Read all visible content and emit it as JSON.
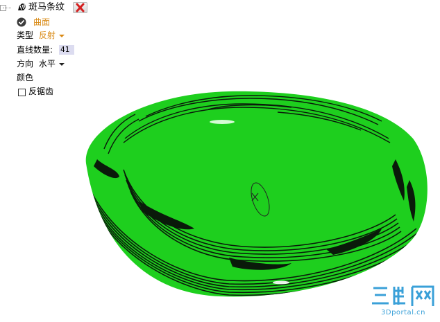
{
  "panel": {
    "title": "斑马条纹",
    "surface_label": "曲面",
    "type_label": "类型",
    "type_value": "反射",
    "line_count_label": "直线数量:",
    "line_count_value": "41",
    "direction_label": "方向",
    "direction_value": "水平",
    "color_label": "颜色",
    "antialias_label": "反锯齿"
  },
  "watermark": {
    "url": "3Dportal.cn"
  },
  "icons": {
    "zebra": "zebra-icon",
    "close": "close-icon",
    "check": "check-circle-icon",
    "checkbox": "checkbox-icon"
  },
  "colors": {
    "accent": "#d98a15",
    "surface_green": "#1ecf1e",
    "stripe_dark": "#0a1a0a",
    "watermark_blue": "#3aa0d8"
  }
}
